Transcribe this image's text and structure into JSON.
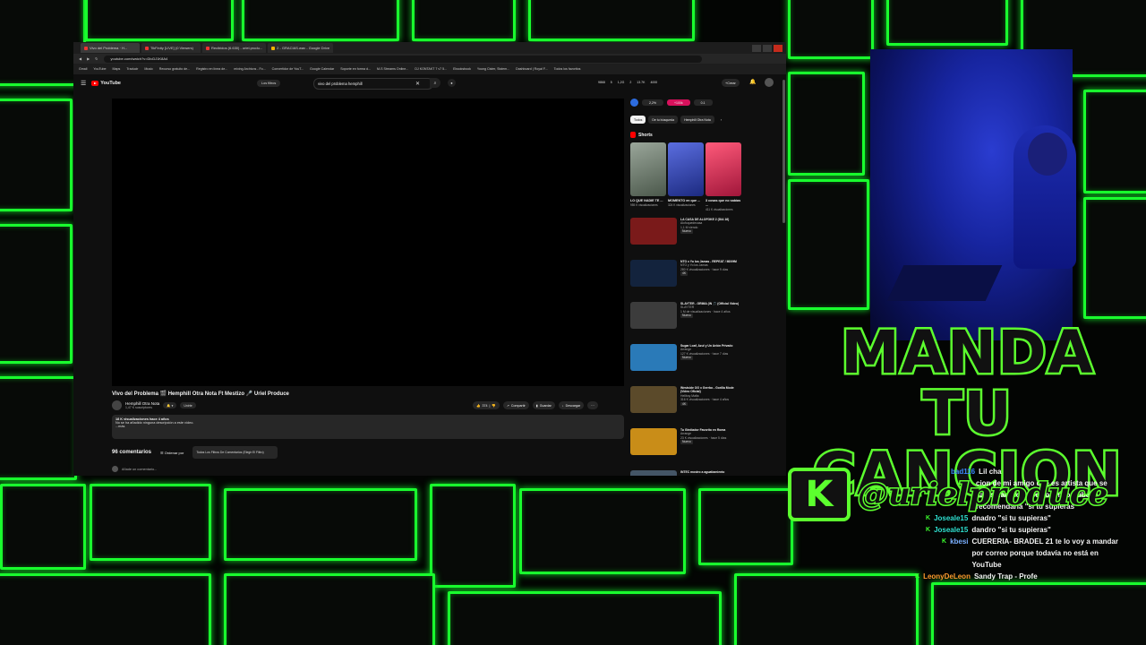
{
  "browser": {
    "tabs": [
      {
        "label": "Vivo del Problema · H...",
        "active": true
      },
      {
        "label": "TikFinity [LIVE] (0 Viewers)",
        "active": false
      },
      {
        "label": "Recibidos (6.630) - uriel.produ...",
        "active": false
      },
      {
        "label": "2 - GRACIAS.wav - Google Drive",
        "active": false
      }
    ],
    "url": "youtube.com/watch?v=DlcDJ1K8A4",
    "bookmarks": [
      "Gmail",
      "YouTube",
      "Maps",
      "Traducir",
      "Music",
      "Recurso gratuito de...",
      "Registro en línea de...",
      "mixing Archivos - Fo...",
      "Convertidor de YouT...",
      "Google Calendar",
      "Soporte en forma d...",
      "M-S Streams Online...",
      "DJ KONTAKT 7 v7 5...",
      "Ebooksbook",
      "Young Cister, Sistem...",
      "Dashboard | Royal F...",
      "Todos los favoritos"
    ]
  },
  "youtube": {
    "logo": "YouTube",
    "filter_pill": "Los filtros",
    "search_query": "vivo del problema hemphill",
    "stats": [
      "9868",
      "5",
      "1,2G",
      "2",
      "13.7K",
      "4000"
    ],
    "create_label": "Crear",
    "video_title": "Vivo del Problema 🎬 Hemphill Otra Nota Ft Mestizo 🎤 Uriel Produce",
    "channel_name": "Hemphill Otra Nota",
    "channel_subs": "1,47 K suscriptores",
    "join_label": "Unirte",
    "actions": {
      "likes": "374",
      "share": "Compartir",
      "save": "Guardar",
      "download": "Descargar"
    },
    "description": {
      "views": "18 K visualizaciones  hace 4 años",
      "text": "No se ha añadido ninguna descripción a este vídeo.",
      "more": "...más"
    },
    "comments_count": "96 comentarios",
    "sort_label": "Ordenar por",
    "comment_filter": "Todos Los Filtros De Comentarios (Elegir El Filtro)",
    "add_comment_placeholder": "Añade un comentario..."
  },
  "sidebar": {
    "ad": [
      "2,2%",
      "+100k",
      "0.1"
    ],
    "chips": [
      "Todos",
      "De tu búsqueda",
      "Hemphill Otra Nota"
    ],
    "shorts_label": "Shorts",
    "shorts": [
      {
        "title": "LO QUE NADIE TE ...",
        "views": "955 K visualizaciones",
        "color": "#6b7a6a"
      },
      {
        "title": "MOMENTO en que ...",
        "views": "324 K visualizaciones",
        "color": "#3448b0"
      },
      {
        "title": "3 cosas que no sabías ...",
        "views": "411 K visualizaciones",
        "color": "#e03a5a"
      }
    ],
    "recommended": [
      {
        "title": "LA CASA DE ALOFOKE 2 (DIA 16)",
        "channel": "Alofoquedecasa",
        "meta": "1,1 M viendo",
        "badge": "Nuevo",
        "color": "#7a1a1a"
      },
      {
        "title": "NTO x Yo los Jamas - REPEAT / MIXHM",
        "channel": "NTO y Yo los Jamas",
        "meta": "280 K visualizaciones · hace 9 días",
        "badge": "4K",
        "color": "#13233d"
      },
      {
        "title": "SLAYTER - GRIMA (IN 🎵 (Official Video)",
        "channel": "SLAYTER",
        "meta": "1 M de visualizaciones · hace 4 años",
        "badge": "Nuevo",
        "color": "#3c3c3c"
      },
      {
        "title": "Sugar Loaf, Azul y Un Avión Privado",
        "channel": "Arrange",
        "meta": "127 K visualizaciones · hace 7 días",
        "badge": "Nuevo",
        "color": "#2a7ab8"
      },
      {
        "title": "Westside OG x Gerrbo - Gorilla Mode (Video Oficial)",
        "channel": "Hellboy Mafia",
        "meta": "316 K visualizaciones · hace 4 años",
        "badge": "4K",
        "color": "#5b4a2a"
      },
      {
        "title": "Tu Glediador Favorito en Roma",
        "channel": "Arrange",
        "meta": "23 K visualizaciones · hace 5 días",
        "badge": "Nuevo",
        "color": "#c98d18"
      },
      {
        "title": "INTEC mostro a aguatiamiento",
        "channel": "",
        "meta": "",
        "badge": "",
        "color": "#445566"
      }
    ]
  },
  "overlay": {
    "banner_line1": "MANDA TU",
    "banner_line2": "CANCION",
    "kick_letter": "K",
    "handle": "@urielproduce"
  },
  "chat": [
    {
      "user": "bad116",
      "text": "Lil cha",
      "user_color": "#3c8cff"
    },
    {
      "user": "",
      "text": "cion de mi amigo que es artista que se llama dandro buscalo en youtube te recomendaría \"si tu supieras\"",
      "user_color": "#ffffff"
    },
    {
      "user": "Joseale15",
      "text": "dnadro \"si tu supieras\"",
      "user_color": "#2ee0d0"
    },
    {
      "user": "Joseale15",
      "text": "dandro \"si tu supieras\"",
      "user_color": "#2ee0d0"
    },
    {
      "user": "kbesi",
      "text": "CUERERIA- BRADEL 21 te lo voy a mandar por correo porque todavía no está en YouTube",
      "user_color": "#7ab0ff"
    },
    {
      "user": "LeonyDeLeon",
      "text": "Sandy Trap - Profe",
      "user_color": "#ff9a2e"
    }
  ]
}
